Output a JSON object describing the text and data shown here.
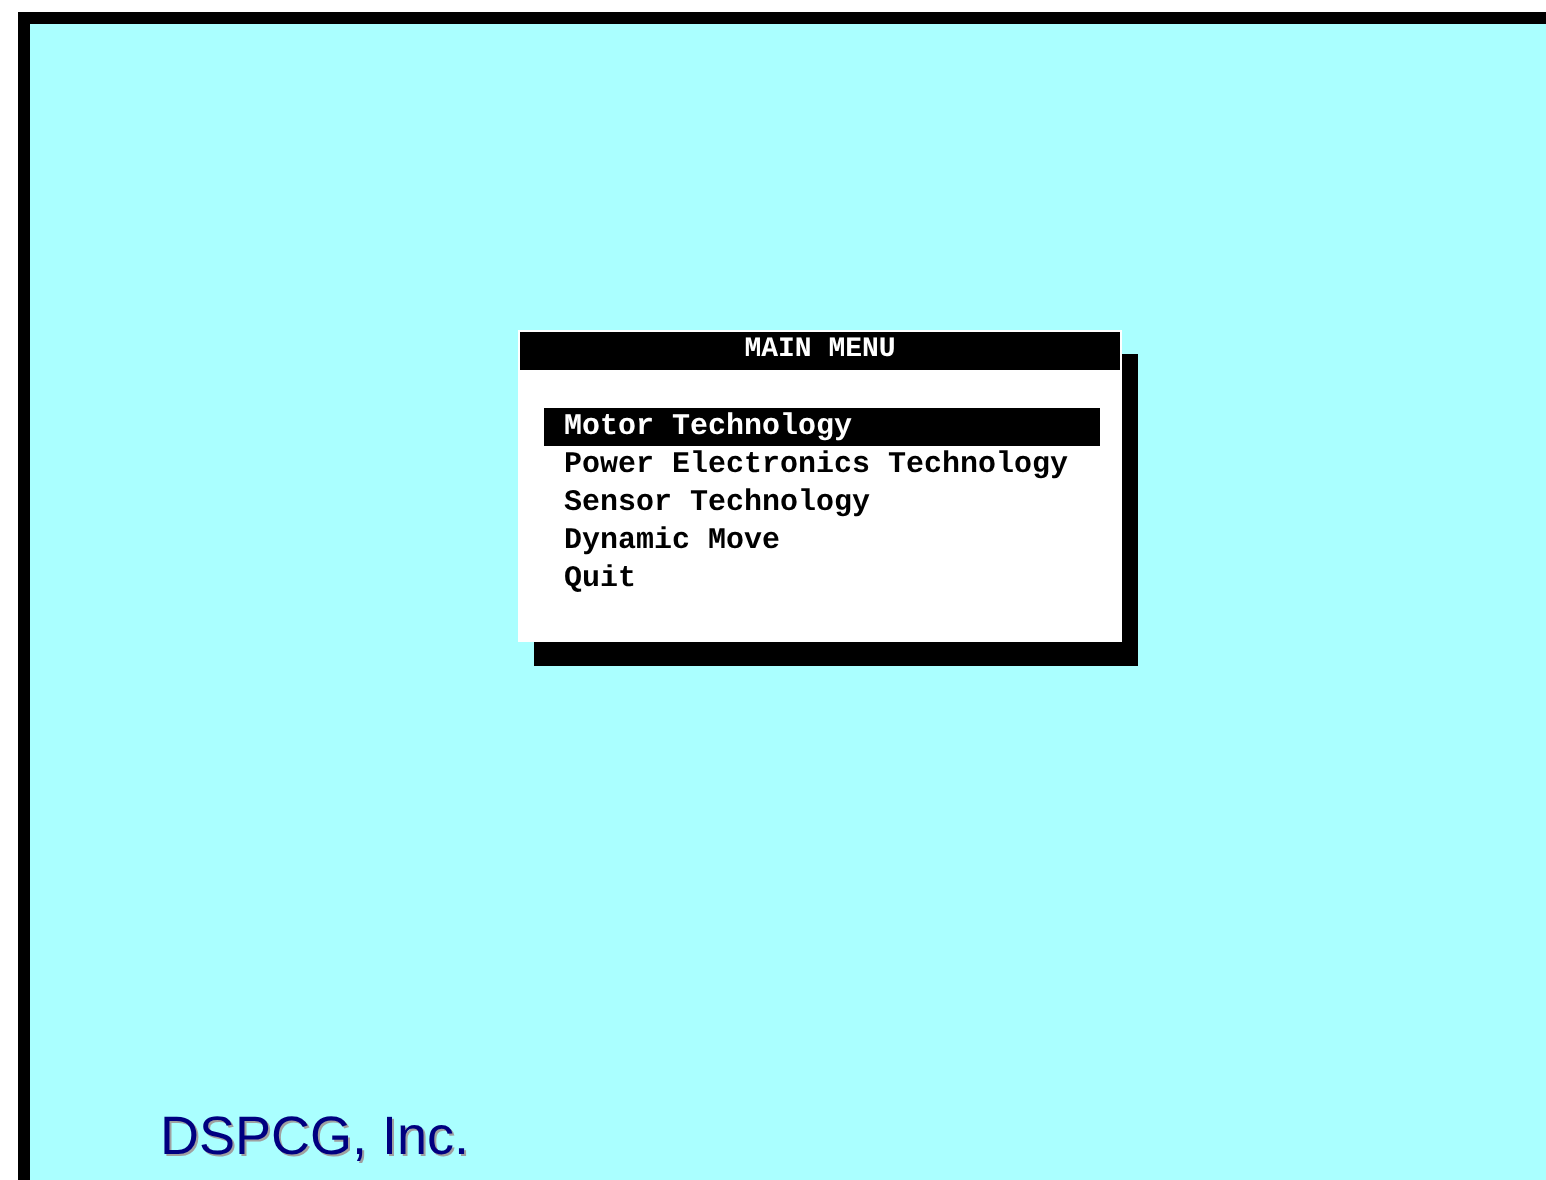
{
  "menu": {
    "title": "MAIN MENU",
    "items": [
      {
        "label": "Motor Technology",
        "selected": true
      },
      {
        "label": "Power Electronics Technology",
        "selected": false
      },
      {
        "label": "Sensor Technology",
        "selected": false
      },
      {
        "label": "Dynamic Move",
        "selected": false
      },
      {
        "label": "Quit",
        "selected": false
      }
    ]
  },
  "footer": {
    "company": "DSPCG, Inc."
  }
}
